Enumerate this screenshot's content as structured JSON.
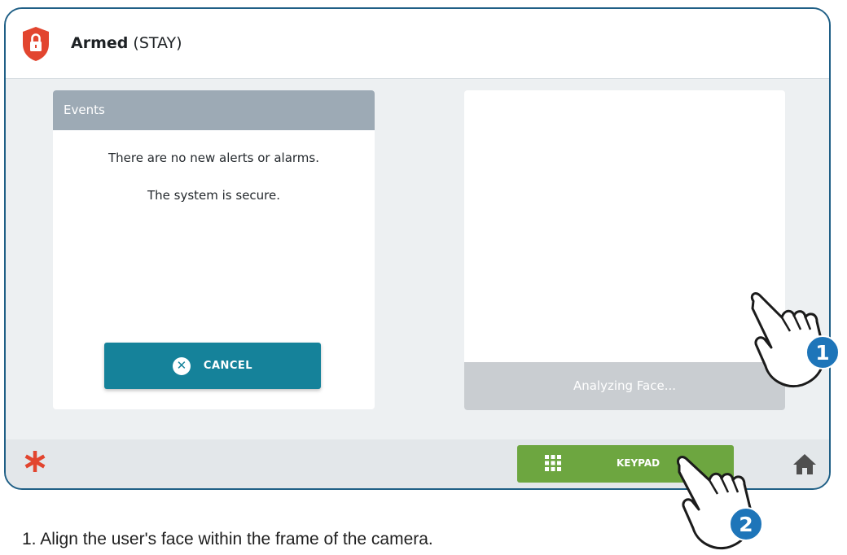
{
  "status": {
    "state_bold": "Armed",
    "state_mode": "(STAY)",
    "icon": "lock-shield-icon",
    "icon_color": "#e2452f"
  },
  "events": {
    "header": "Events",
    "line1": "There are no new alerts or alarms.",
    "line2": "The system is secure."
  },
  "cancel_button": {
    "label": "CANCEL",
    "icon": "close-circle-icon",
    "color": "#15829a"
  },
  "camera": {
    "status": "Analyzing Face..."
  },
  "bottom_bar": {
    "left_icon": "asterisk-icon",
    "keypad_label": "KEYPAD",
    "keypad_icon": "keypad-grid-icon",
    "keypad_color": "#6da640",
    "right_icon": "home-icon"
  },
  "callouts": [
    {
      "number": "1",
      "icon": "pointing-hand-icon"
    },
    {
      "number": "2",
      "icon": "pointing-hand-icon"
    }
  ],
  "instruction": "1.   Align the user's face within the frame of the camera."
}
